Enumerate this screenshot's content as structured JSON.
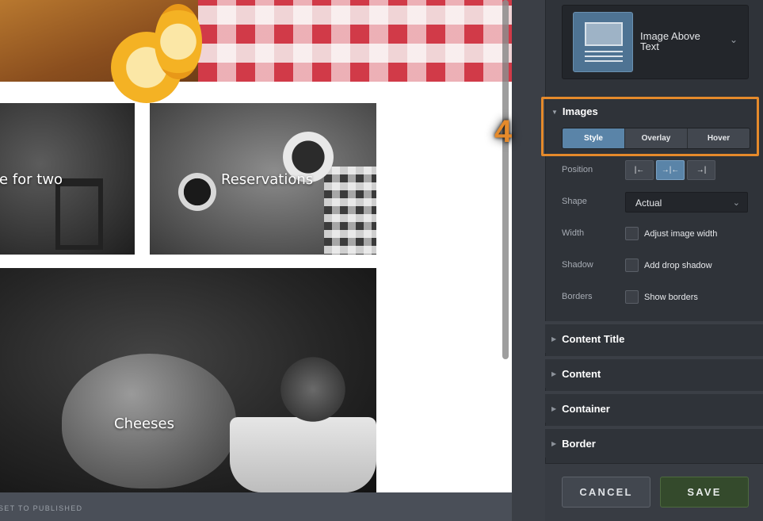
{
  "preview": {
    "tiles": [
      {
        "label": "le for two"
      },
      {
        "label": "Reservations"
      },
      {
        "label": "Cheeses"
      }
    ],
    "footer_link": "SET TO PUBLISHED"
  },
  "panel": {
    "layout": {
      "name": "Image Above Text",
      "chevron_icon": "chevron-down-icon"
    },
    "images_section": {
      "title": "Images",
      "step_number": "4",
      "tabs": [
        {
          "label": "Style",
          "active": true
        },
        {
          "label": "Overlay",
          "active": false
        },
        {
          "label": "Hover",
          "active": false
        }
      ],
      "position": {
        "label": "Position",
        "options": [
          {
            "glyph": "|←",
            "icon": "align-left-icon",
            "active": false
          },
          {
            "glyph": "→|←",
            "icon": "align-center-icon",
            "active": true
          },
          {
            "glyph": "→|",
            "icon": "align-right-icon",
            "active": false
          }
        ]
      },
      "shape": {
        "label": "Shape",
        "value": "Actual"
      },
      "width": {
        "label": "Width",
        "checkbox_label": "Adjust image width",
        "checked": false
      },
      "shadow": {
        "label": "Shadow",
        "checkbox_label": "Add drop shadow",
        "checked": false
      },
      "borders": {
        "label": "Borders",
        "checkbox_label": "Show borders",
        "checked": false
      }
    },
    "sections": [
      {
        "title": "Content Title"
      },
      {
        "title": "Content"
      },
      {
        "title": "Container"
      },
      {
        "title": "Border"
      }
    ],
    "buttons": {
      "cancel": "CANCEL",
      "save": "SAVE"
    }
  },
  "colors": {
    "accent_orange": "#e58a2b",
    "active_blue": "#5a84a8",
    "save_green": "#344a2c",
    "panel_bg": "#2f3339"
  }
}
